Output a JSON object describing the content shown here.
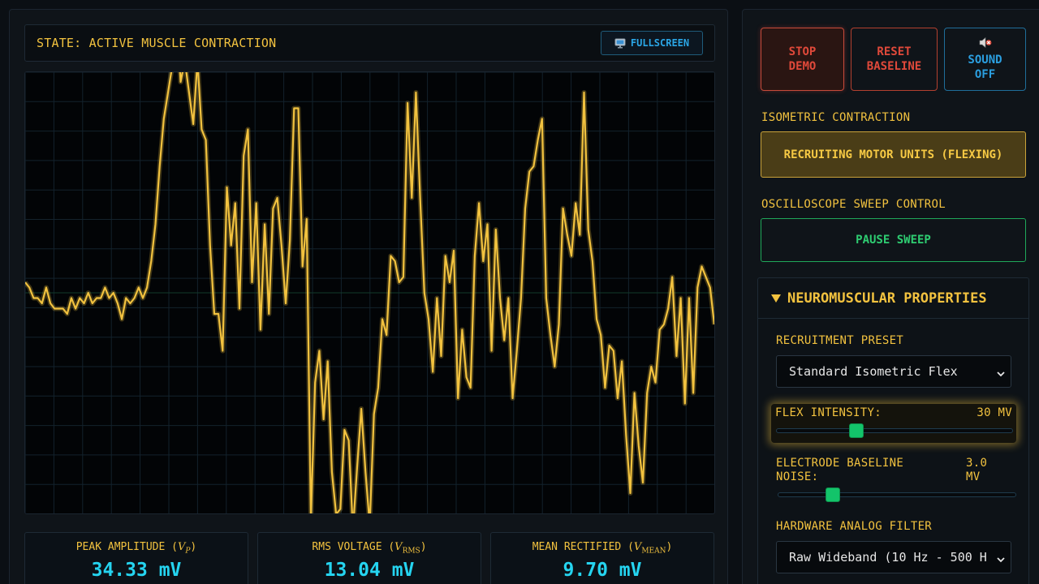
{
  "state": {
    "text": "STATE: ACTIVE MUSCLE CONTRACTION"
  },
  "fullscreen": {
    "icon": "monitor-icon",
    "label": "FULLSCREEN"
  },
  "scope": {
    "trace_color": "#f2c23f",
    "grid_color": "#13222c",
    "samples": [
      2,
      1,
      -1,
      -1,
      -2,
      1,
      -2,
      -3,
      -3,
      -3,
      -4,
      -1,
      -3,
      -1,
      -2,
      0,
      -2,
      -1,
      -1,
      1,
      -1,
      0,
      -2,
      -5,
      -1,
      -2,
      -1,
      1,
      -1,
      1,
      6,
      13,
      24,
      33,
      38,
      43,
      54,
      40,
      44,
      38,
      32,
      44,
      31,
      29,
      9,
      -4,
      -4,
      -11,
      20,
      9,
      17,
      -3,
      26,
      31,
      2,
      17,
      -7,
      13,
      -4,
      16,
      18,
      9,
      -2,
      10,
      35,
      35,
      5,
      14,
      -43,
      -17,
      -11,
      -24,
      -13,
      -34,
      -42,
      -41,
      -26,
      -28,
      -45,
      -33,
      -22,
      -34,
      -44,
      -23,
      -18,
      -5,
      -8,
      7,
      6,
      2,
      3,
      36,
      18,
      38,
      18,
      0,
      -5,
      -15,
      -1,
      -12,
      7,
      2,
      8,
      -20,
      -7,
      -16,
      -18,
      7,
      17,
      6,
      13,
      -11,
      12,
      -1,
      -9,
      -1,
      -20,
      -11,
      -1,
      16,
      23,
      24,
      29,
      33,
      -1,
      -8,
      -14,
      -6,
      16,
      11,
      7,
      17,
      11,
      38,
      12,
      6,
      -5,
      -8,
      -18,
      -10,
      -11,
      -20,
      -13,
      -27,
      -38,
      -19,
      -29,
      -36,
      -19,
      -14,
      -17,
      -7,
      -6,
      -3,
      3,
      -12,
      -1,
      -21,
      -1,
      -19,
      1,
      5,
      3,
      1,
      -6
    ]
  },
  "stats": [
    {
      "label": "PEAK AMPLITUDE (",
      "sym": "V",
      "sub": "P",
      "close": ")",
      "value": "34.33 mV"
    },
    {
      "label": "RMS VOLTAGE (",
      "sym": "V",
      "sub": "RMS",
      "close": ")",
      "value": "13.04 mV"
    },
    {
      "label": "MEAN RECTIFIED (",
      "sym": "V",
      "sub": "MEAN",
      "close": ")",
      "value": "9.70 mV"
    }
  ],
  "controls": {
    "stop": {
      "line1": "STOP",
      "line2": "DEMO"
    },
    "reset": {
      "line1": "RESET",
      "line2": "BASELINE"
    },
    "sound": {
      "icon": "speaker-muted-icon",
      "line1": "SOUND",
      "line2": "OFF"
    }
  },
  "isometric": {
    "label": "ISOMETRIC CONTRACTION",
    "button": "RECRUITING MOTOR UNITS (FLEXING)"
  },
  "sweep": {
    "label": "OSCILLOSCOPE SWEEP CONTROL",
    "button": "PAUSE SWEEP"
  },
  "properties": {
    "title": "NEUROMUSCULAR PROPERTIES",
    "preset_label": "RECRUITMENT PRESET",
    "preset_value": "Standard Isometric Flex",
    "intensity_label": "FLEX INTENSITY:",
    "intensity_value": "30 MV",
    "intensity_fraction": 0.34,
    "noise_label_1": "ELECTRODE BASELINE",
    "noise_label_2": "NOISE:",
    "noise_value_1": "3.0",
    "noise_value_2": "MV",
    "noise_fraction": 0.23,
    "filter_label": "HARDWARE ANALOG FILTER",
    "filter_value": "Raw Wideband (10 Hz - 500 H"
  }
}
